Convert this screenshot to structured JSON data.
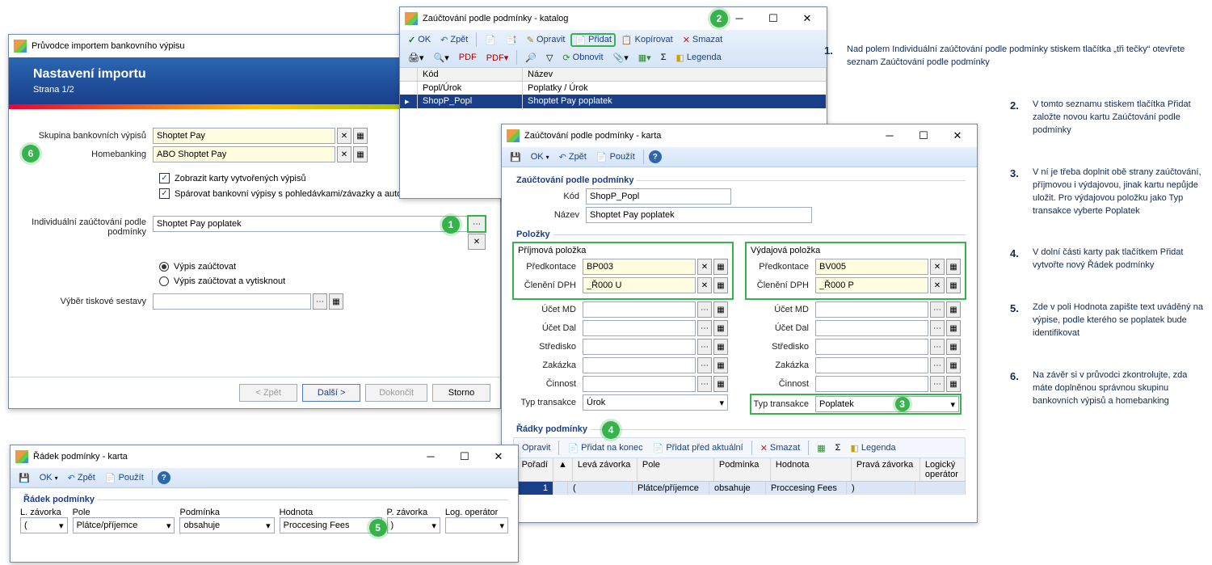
{
  "wiz": {
    "title": "Průvodce importem bankovního výpisu",
    "head": "Nastavení importu",
    "page": "Strana 1/2",
    "f_group_label": "Skupina bankovních výpisů",
    "f_group_val": "Shoptet Pay",
    "f_hb_label": "Homebanking",
    "f_hb_val": "ABO Shoptet Pay",
    "chk1": "Zobrazit karty vytvořených výpisů",
    "chk2": "Spárovat bankovní výpisy s pohledávkami/závazky a automaticky tvořit úhrady",
    "f_ind_label": "Individuální zaúčtování podle podmínky",
    "f_ind_val": "Shoptet Pay poplatek",
    "r1": "Výpis zaúčtovat",
    "r2": "Výpis zaúčtovat a vytisknout",
    "f_print_label": "Výběr tiskové sestavy",
    "btn_back": "< Zpět",
    "btn_next": "Další >",
    "btn_finish": "Dokončit",
    "btn_cancel": "Storno"
  },
  "catalog": {
    "title": "Zaúčtování podle podmínky - katalog",
    "tb": {
      "ok": "OK",
      "undo": "Zpět",
      "edit": "Opravit",
      "add": "Přidat",
      "copy": "Kopírovat",
      "del": "Smazat",
      "refresh": "Obnovit",
      "legend": "Legenda"
    },
    "cols": {
      "code": "Kód",
      "name": "Název"
    },
    "rows": [
      {
        "code": "Popl/Úrok",
        "name": "Poplatky / Úrok"
      },
      {
        "code": "ShopP_Popl",
        "name": "Shoptet Pay poplatek"
      }
    ]
  },
  "card": {
    "title": "Zaúčtování podle podmínky - karta",
    "tb": {
      "ok": "OK",
      "undo": "Zpět",
      "use": "Použít"
    },
    "sec_main": "Zaúčtování podle podmínky",
    "f_code_label": "Kód",
    "f_code_val": "ShopP_Popl",
    "f_name_label": "Název",
    "f_name_val": "Shoptet Pay poplatek",
    "sec_items": "Položky",
    "income_title": "Příjmová položka",
    "expense_title": "Výdajová položka",
    "l_predk": "Předkontace",
    "l_dph": "Členění DPH",
    "l_md": "Účet MD",
    "l_dal": "Účet Dal",
    "l_str": "Středisko",
    "l_zak": "Zakázka",
    "l_cin": "Činnost",
    "l_typ": "Typ transakce",
    "in": {
      "predk": "BP003",
      "dph": "_Ř000 U",
      "typ": "Úrok"
    },
    "ex": {
      "predk": "BV005",
      "dph": "_Ř000 P",
      "typ": "Poplatek"
    },
    "sec_rows": "Řádky podmínky",
    "rows_tb": {
      "edit": "Opravit",
      "addend": "Přidat na konec",
      "addbefore": "Přidat před aktuální",
      "del": "Smazat",
      "legend": "Legenda"
    },
    "grid_cols": {
      "ord": "Pořadí",
      "open": "",
      "lz": "Levá závorka",
      "pole": "Pole",
      "pod": "Podmínka",
      "hod": "Hodnota",
      "rz": "Pravá závorka",
      "log": "Logický operátor"
    },
    "grid_row": {
      "ord": "1",
      "lz": "(",
      "pole": "Plátce/příjemce",
      "pod": "obsahuje",
      "hod": "Proccesing Fees",
      "rz": ")",
      "log": ""
    }
  },
  "row": {
    "title": "Řádek podmínky - karta",
    "tb": {
      "ok": "OK",
      "undo": "Zpět",
      "use": "Použít"
    },
    "sec": "Řádek podmínky",
    "cols": {
      "lz": "L. závorka",
      "pole": "Pole",
      "pod": "Podmínka",
      "hod": "Hodnota",
      "rz": "P. závorka",
      "log": "Log. operátor"
    },
    "vals": {
      "lz": "(",
      "pole": "Plátce/příjemce",
      "pod": "obsahuje",
      "hod": "Proccesing Fees",
      "rz": ")",
      "log": ""
    }
  },
  "instr": [
    "Nad polem Individuální zaúčtování podle podmínky stiskem tlačítka „tři tečky“ otevřete seznam Zaúčtování podle podmínky",
    "V tomto seznamu stiskem tlačítka Přidat založte novou kartu Zaúčtování podle podmínky",
    "V ní je třeba doplnit obě strany zaúčtování, příjmovou i výdajovou, jinak kartu nepůjde uložit. Pro výdajovou položku jako Typ transakce vyberte Poplatek",
    "V dolní části karty pak tlačítkem Přidat vytvořte nový Řádek podmínky",
    "Zde v poli Hodnota zapište text uváděný na výpise, podle kterého se poplatek bude identifikovat",
    "Na závěr si v průvodci zkontrolujte, zda máte doplněnou správnou skupinu bankovních výpisů a homebanking"
  ]
}
